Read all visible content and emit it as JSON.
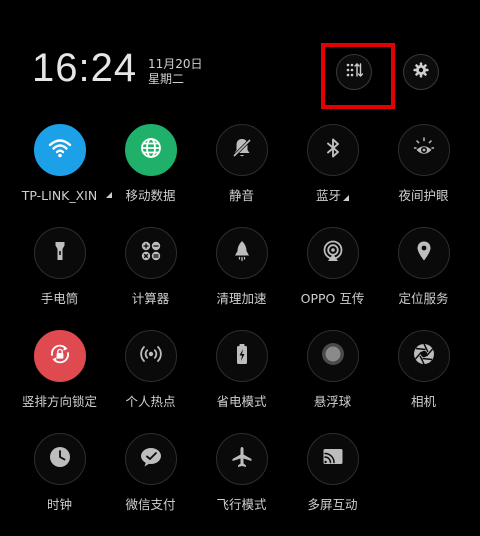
{
  "status": {
    "time": "16:24",
    "date": "11月20日",
    "weekday": "星期二"
  },
  "header": {
    "edit_icon": "grid-sort-icon",
    "settings_icon": "gear-icon",
    "highlight_color": "#e30000"
  },
  "tiles": [
    {
      "label": "TP-LINK_XIN",
      "icon": "wifi-icon",
      "active": true,
      "color": "#1ca0e8"
    },
    {
      "label": "移动数据",
      "icon": "globe-icon",
      "active": true,
      "color": "#1fb06a"
    },
    {
      "label": "静音",
      "icon": "bell-off-icon",
      "active": false
    },
    {
      "label": "蓝牙",
      "icon": "bluetooth-icon",
      "active": false
    },
    {
      "label": "夜间护眼",
      "icon": "eye-sun-icon",
      "active": false
    },
    {
      "label": "手电筒",
      "icon": "flashlight-icon",
      "active": false
    },
    {
      "label": "计算器",
      "icon": "calculator-icon",
      "active": false
    },
    {
      "label": "清理加速",
      "icon": "rocket-icon",
      "active": false
    },
    {
      "label": "OPPO 互传",
      "icon": "share-signal-icon",
      "active": false
    },
    {
      "label": "定位服务",
      "icon": "location-pin-icon",
      "active": false
    },
    {
      "label": "竖排方向锁定",
      "icon": "rotation-lock-icon",
      "active": true,
      "color": "#de4a50"
    },
    {
      "label": "个人热点",
      "icon": "hotspot-icon",
      "active": false
    },
    {
      "label": "省电模式",
      "icon": "battery-saver-icon",
      "active": false
    },
    {
      "label": "悬浮球",
      "icon": "floating-ball-icon",
      "active": false
    },
    {
      "label": "相机",
      "icon": "camera-aperture-icon",
      "active": false
    },
    {
      "label": "时钟",
      "icon": "clock-icon",
      "active": false
    },
    {
      "label": "微信支付",
      "icon": "wechat-pay-icon",
      "active": false
    },
    {
      "label": "飞行模式",
      "icon": "airplane-icon",
      "active": false
    },
    {
      "label": "多屏互动",
      "icon": "cast-icon",
      "active": false
    }
  ]
}
